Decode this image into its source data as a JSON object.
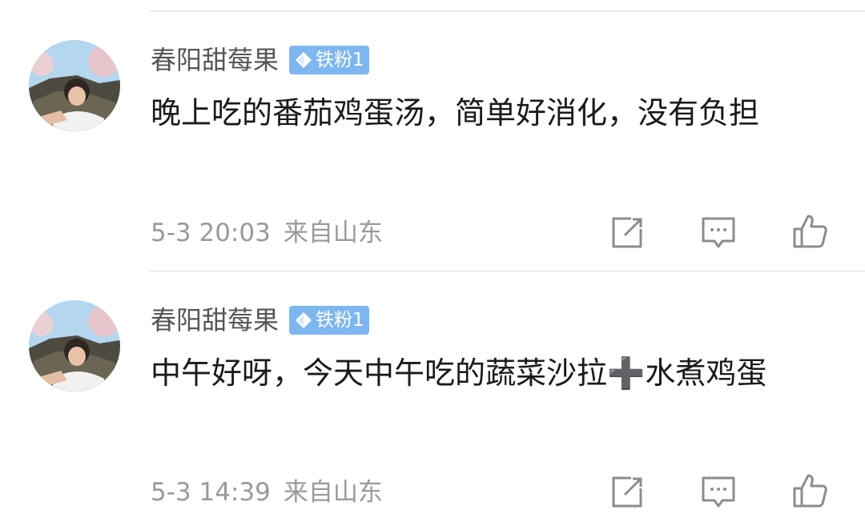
{
  "comments": [
    {
      "username": "春阳甜莓果",
      "badge": "铁粉1",
      "text": "晚上吃的番茄鸡蛋汤，简单好消化，没有负担",
      "time": "5-3 20:03",
      "location": "来自山东",
      "avatar_icon": "user-avatar-photo"
    },
    {
      "username": "春阳甜莓果",
      "badge": "铁粉1",
      "text": "中午好呀，今天中午吃的蔬菜沙拉➕水煮鸡蛋",
      "time": "5-3 14:39",
      "location": "来自山东",
      "avatar_icon": "user-avatar-photo"
    }
  ],
  "actions": {
    "share_icon": "share-icon",
    "reply_icon": "comment-icon",
    "like_icon": "thumbs-up-icon"
  },
  "colors": {
    "badge_background": "#7eb7ef",
    "username": "#555555",
    "text": "#1a1a1a",
    "meta": "#9a9a9a",
    "icon": "#8c8c8c",
    "divider": "#ededed"
  }
}
